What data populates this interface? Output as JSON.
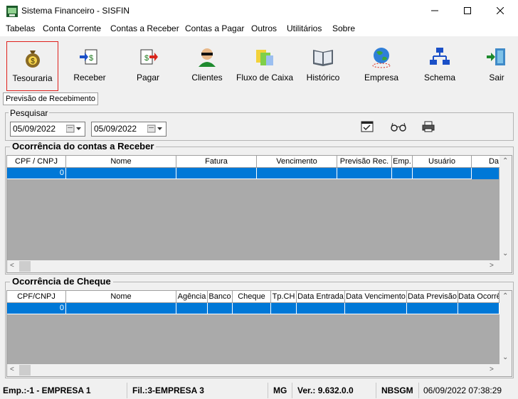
{
  "window": {
    "title": "Sistema Financeiro - SISFIN"
  },
  "menu": [
    "Tabelas",
    "Conta Corrente",
    "Contas a Receber",
    "Contas a Pagar",
    "Outros",
    "Utilitários",
    "Sobre"
  ],
  "toolbar": [
    {
      "label": "Tesouraria",
      "icon": "money-bag-icon"
    },
    {
      "label": "Receber",
      "icon": "receive-icon"
    },
    {
      "label": "Pagar",
      "icon": "pay-icon"
    },
    {
      "label": "Clientes",
      "icon": "client-icon"
    },
    {
      "label": "Fluxo de Caixa",
      "icon": "cash-flow-icon"
    },
    {
      "label": "Histórico",
      "icon": "history-book-icon"
    },
    {
      "label": "Empresa",
      "icon": "globe-icon"
    },
    {
      "label": "Schema",
      "icon": "schema-icon"
    },
    {
      "label": "Sair",
      "icon": "exit-door-icon"
    }
  ],
  "tab": {
    "label": "Previsão de Recebimento"
  },
  "search": {
    "title": "Pesquisar",
    "date_from": "05/09/2022",
    "date_to": "05/09/2022"
  },
  "receivables": {
    "title": "Ocorrência do contas a Receber",
    "columns": [
      "CPF / CNPJ",
      "Nome",
      "Fatura",
      "Vencimento",
      "Previsão Rec.",
      "Emp.",
      "Usuário",
      "Da"
    ],
    "rows": [
      {
        "cpf": "0"
      }
    ]
  },
  "cheques": {
    "title": "Ocorrência de Cheque",
    "columns": [
      "CPF/CNPJ",
      "Nome",
      "Agência",
      "Banco",
      "Cheque",
      "Tp.CH",
      "Data Entrada",
      "Data Vencimento",
      "Data Previsão",
      "Data Ocorrê"
    ],
    "rows": [
      {
        "cpf": "0"
      }
    ]
  },
  "status": {
    "empresa": "Emp.:-1 - EMPRESA 1",
    "filial": "Fil.:3-EMPRESA 3",
    "uf": "MG",
    "version": "Ver.: 9.632.0.0",
    "user": "NBSGM",
    "datetime": "06/09/2022 07:38:29"
  }
}
